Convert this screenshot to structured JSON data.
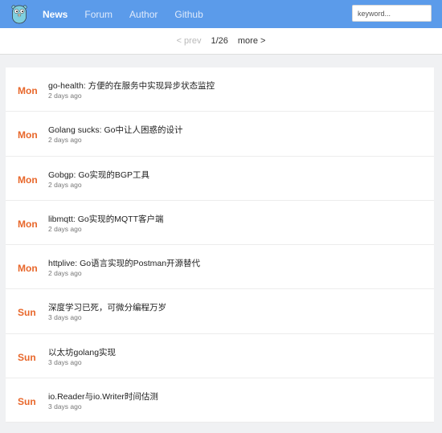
{
  "nav": {
    "links": [
      {
        "label": "News",
        "active": true
      },
      {
        "label": "Forum"
      },
      {
        "label": "Author"
      },
      {
        "label": "Github"
      }
    ],
    "search_placeholder": "keyword..."
  },
  "pager": {
    "prev": "< prev",
    "current": "1/26",
    "more": "more >"
  },
  "items": [
    {
      "day": "Mon",
      "title": "go-health: 方便的在服务中实现异步状态监控",
      "time": "2 days ago"
    },
    {
      "day": "Mon",
      "title": "Golang sucks: Go中让人困惑的设计",
      "time": "2 days ago"
    },
    {
      "day": "Mon",
      "title": "Gobgp: Go实现的BGP工具",
      "time": "2 days ago"
    },
    {
      "day": "Mon",
      "title": "libmqtt: Go实现的MQTT客户端",
      "time": "2 days ago"
    },
    {
      "day": "Mon",
      "title": "httplive: Go语言实现的Postman开源替代",
      "time": "2 days ago"
    },
    {
      "day": "Sun",
      "title": "深度学习已死，可微分编程万岁",
      "time": "3 days ago"
    },
    {
      "day": "Sun",
      "title": "以太坊golang实现",
      "time": "3 days ago"
    },
    {
      "day": "Sun",
      "title": "io.Reader与io.Writer时间估测",
      "time": "3 days ago"
    }
  ],
  "colors": {
    "navbar": "#5b9bea",
    "day_accent": "#e8672b"
  },
  "logo_icon": "gopher-logo-icon"
}
